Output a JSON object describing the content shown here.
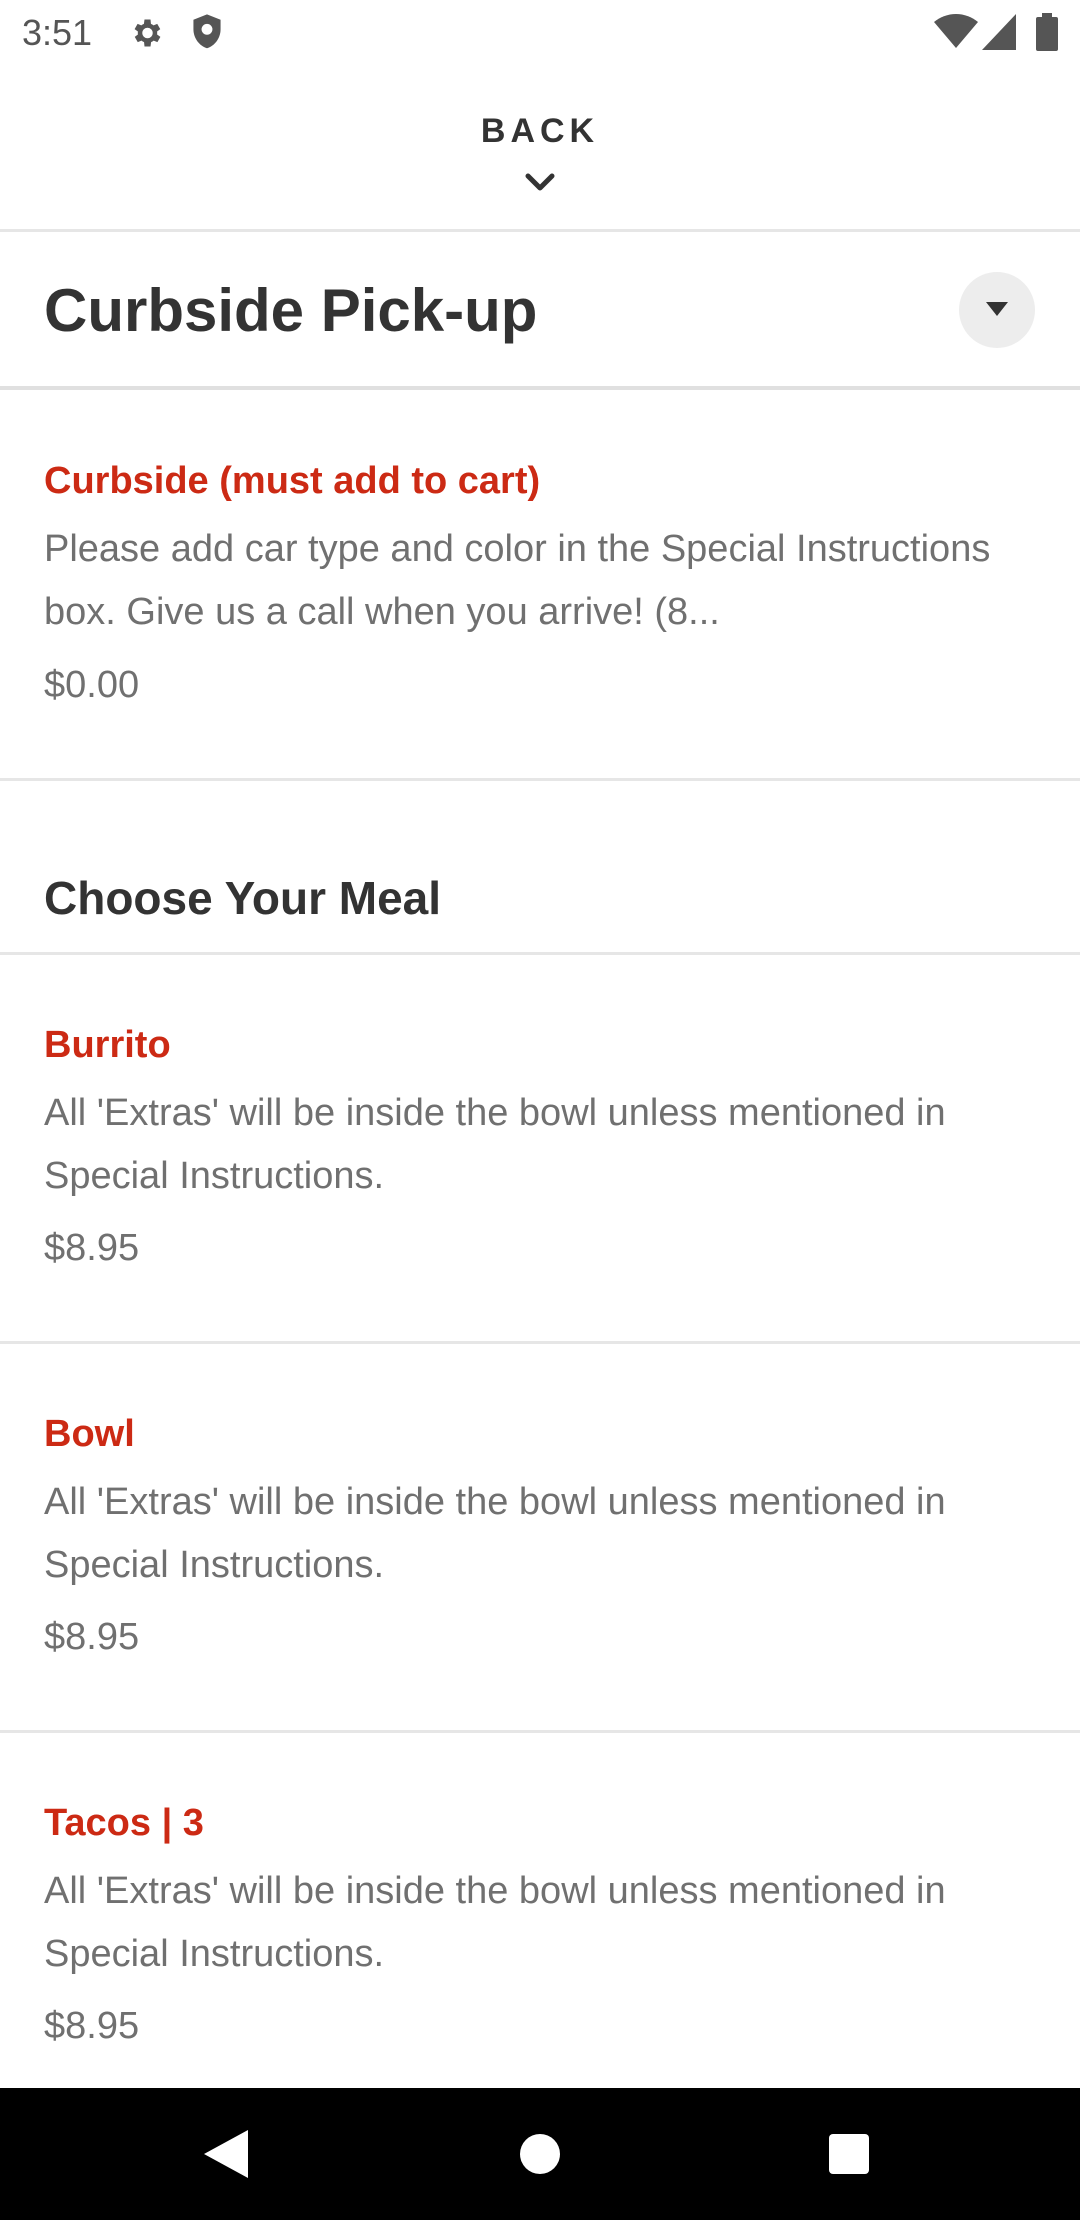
{
  "status_bar": {
    "time": "3:51",
    "icons": [
      "gear-icon",
      "shield-icon",
      "wifi-icon",
      "signal-icon",
      "battery-icon"
    ]
  },
  "header": {
    "back_label": "BACK",
    "back_icon": "chevron-down-icon"
  },
  "section": {
    "title": "Curbside Pick-up",
    "toggle_icon": "caret-down-icon"
  },
  "curbside_item": {
    "name": "Curbside (must add to cart)",
    "description": "Please add car type and color in the Special Instructions box. Give us a call when you arrive! (8...",
    "price": "$0.00"
  },
  "category": {
    "title": "Choose Your Meal"
  },
  "meal_items": [
    {
      "name": "Burrito",
      "description": "All 'Extras' will be inside the bowl unless mentioned in Special Instructions.",
      "price": "$8.95"
    },
    {
      "name": "Bowl",
      "description": "All 'Extras' will be inside the bowl unless mentioned in Special Instructions.",
      "price": "$8.95"
    },
    {
      "name": "Tacos | 3",
      "description": "All 'Extras' will be inside the bowl unless mentioned in Special Instructions.",
      "price": "$8.95"
    }
  ],
  "nav_bar": {
    "icons": [
      "nav-back-icon",
      "nav-home-icon",
      "nav-recents-icon"
    ]
  },
  "colors": {
    "item_name": "#cc2a14",
    "text_dark": "#333333",
    "text_muted": "#707070",
    "divider": "#e6e6e6",
    "nav_bar": "#000000"
  }
}
